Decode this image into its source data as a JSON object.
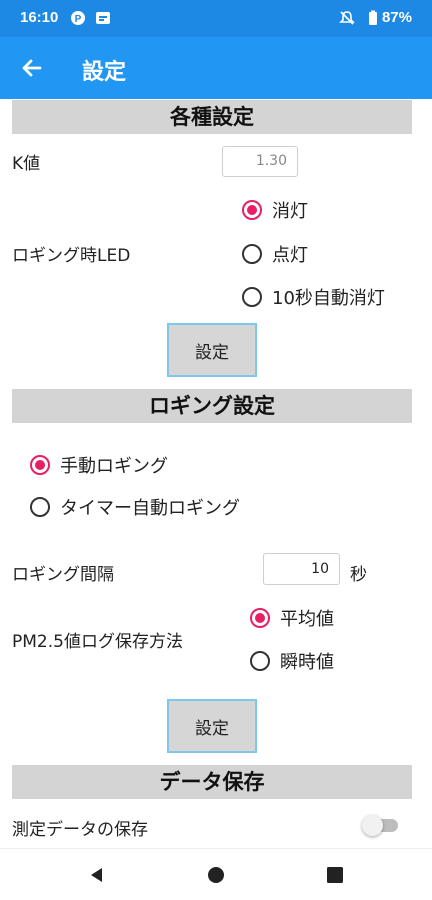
{
  "status_bar": {
    "time": "16:10",
    "battery": "87%",
    "icons": [
      "p-badge-icon",
      "media-icon",
      "mute-icon",
      "battery-icon"
    ]
  },
  "app_bar": {
    "title": "設定",
    "back_icon": "back-arrow-icon"
  },
  "general_settings": {
    "header": "各種設定",
    "k_value_label": "K値",
    "k_value": "1.30",
    "led_label": "ロギング時LED",
    "led_options": [
      "消灯",
      "点灯",
      "10秒自動消灯"
    ],
    "led_selected": 0,
    "set_button": "設定"
  },
  "logging_settings": {
    "header": "ロギング設定",
    "mode_options": [
      "手動ロギング",
      "タイマー自動ロギング"
    ],
    "mode_selected": 0,
    "interval_label": "ロギング間隔",
    "interval_value": "10",
    "interval_unit": "秒",
    "pm25_label": "PM2.5値ログ保存方法",
    "pm25_options": [
      "平均値",
      "瞬時値"
    ],
    "pm25_selected": 0,
    "set_button": "設定"
  },
  "data_save": {
    "header": "データ保存",
    "save_label": "測定データの保存",
    "save_enabled": false
  },
  "colors": {
    "status_bar": "#1e88e5",
    "app_bar": "#2196f3",
    "radio_checked": "#e91e63",
    "section_header_bg": "#d4d4d4",
    "button_border": "#7ec8ee"
  },
  "nav_bar": {
    "icons": [
      "back-triangle-icon",
      "home-circle-icon",
      "recents-square-icon"
    ]
  }
}
